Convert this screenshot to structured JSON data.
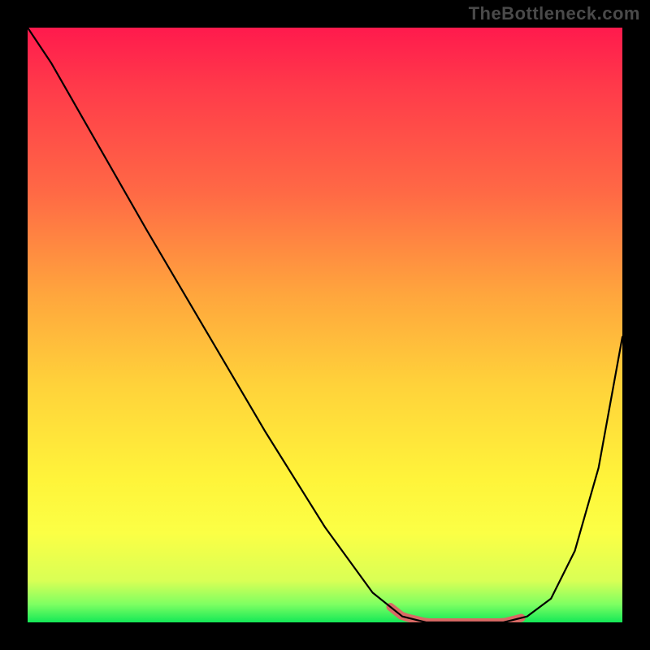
{
  "watermark": "TheBottleneck.com",
  "colors": {
    "page_bg": "#000000",
    "curve": "#000000",
    "highlight": "#d96a65",
    "gradient_top": "#ff1a4d",
    "gradient_bottom": "#14e857"
  },
  "chart_data": {
    "type": "line",
    "title": "",
    "xlabel": "",
    "ylabel": "",
    "xlim": [
      0,
      100
    ],
    "ylim": [
      0,
      100
    ],
    "x": [
      0,
      4,
      8,
      12,
      20,
      30,
      40,
      50,
      58,
      63,
      67,
      71,
      76,
      80,
      84,
      88,
      92,
      96,
      100
    ],
    "values": [
      100,
      94,
      87,
      80,
      66,
      49,
      32,
      16,
      5,
      1,
      0,
      0,
      0,
      0,
      1,
      4,
      12,
      26,
      48
    ],
    "highlight_x_range": [
      61,
      83
    ],
    "annotations": []
  }
}
